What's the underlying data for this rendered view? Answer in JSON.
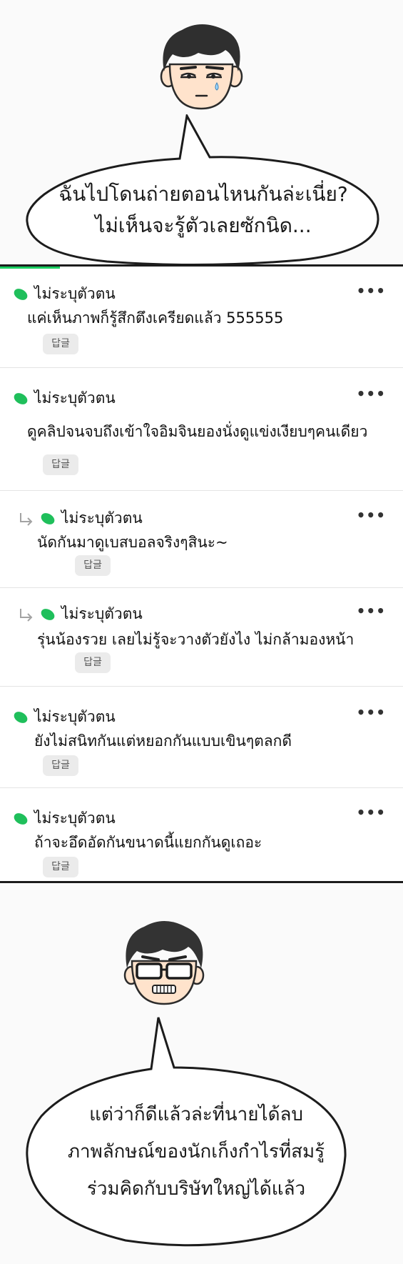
{
  "top_bubble": {
    "lines": [
      "ฉันไปโดนถ่ายตอนไหนกันล่ะเนี่ย?",
      "ไม่เห็นจะรู้ตัวเลยซักนิด..."
    ]
  },
  "comments": [
    {
      "name": "ไม่ระบุตัวตน",
      "text": "แค่เห็นภาพก็รู้สึกตึงเครียดแล้ว 555555",
      "reply": "답글",
      "more": "•••",
      "is_reply": false
    },
    {
      "name": "ไม่ระบุตัวตน",
      "text": "ดูคลิปจนจบถึงเข้าใจอิมจินยองนั่งดูแข่งเงียบๆคนเดียว",
      "reply": "답글",
      "more": "•••",
      "is_reply": false
    },
    {
      "name": "ไม่ระบุตัวตน",
      "text": "นัดกันมาดูเบสบอลจริงๆสินะ~",
      "reply": "답글",
      "more": "•••",
      "is_reply": true
    },
    {
      "name": "ไม่ระบุตัวตน",
      "text": "รุ่นน้องรวย เลยไม่รู้จะวางตัวยังไง ไม่กล้ามองหน้า",
      "reply": "답글",
      "more": "•••",
      "is_reply": true
    },
    {
      "name": "ไม่ระบุตัวตน",
      "text": "ยังไม่สนิทกันแต่หยอกกันแบบเขินๆตลกดี",
      "reply": "답글",
      "more": "•••",
      "is_reply": false
    },
    {
      "name": "ไม่ระบุตัวตน",
      "text": "ถ้าจะอึดอัดกันขนาดนี้แยกกันดูเถอะ",
      "reply": "답글",
      "more": "•••",
      "is_reply": false
    }
  ],
  "bottom_bubble": {
    "lines": [
      "แต่ว่าก็ดีแล้วล่ะที่นายได้ลบ",
      "ภาพลักษณ์ของนักเก็งกำไรที่สมรู้",
      "ร่วมคิดกับบริษัทใหญ่ได้แล้ว"
    ]
  },
  "colors": {
    "accent_green": "#19ce60",
    "leaf_green": "#1fbf5b",
    "reply_button_bg": "#ebebeb"
  },
  "icons": {
    "name_icon": "green-leaf-icon",
    "reply_indent_icon": "reply-arrow-icon",
    "more_icon": "more-dots-icon"
  }
}
